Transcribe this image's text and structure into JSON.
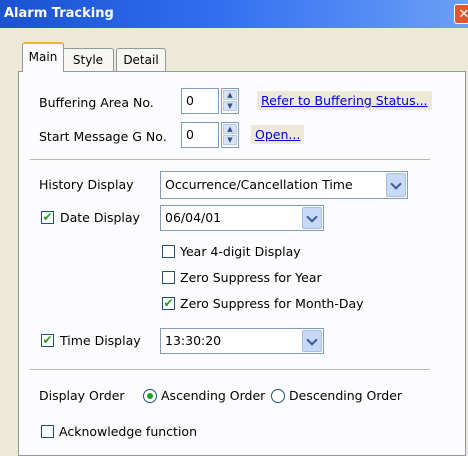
{
  "window": {
    "title": "Alarm Tracking",
    "close_glyph": "✕"
  },
  "tabs": [
    {
      "label": "Main",
      "active": true
    },
    {
      "label": "Style",
      "active": false
    },
    {
      "label": "Detail",
      "active": false
    }
  ],
  "buffering": {
    "label": "Buffering Area No.",
    "value": "0",
    "link": "Refer to Buffering Status..."
  },
  "start_message": {
    "label": "Start Message  G No.",
    "value": "0",
    "link": "Open..."
  },
  "history": {
    "label": "History Display",
    "selected": "Occurrence/Cancellation Time"
  },
  "date_display": {
    "label": "Date Display",
    "checked": true,
    "selected": "06/04/01"
  },
  "options": [
    {
      "label": "Year 4-digit Display",
      "checked": false
    },
    {
      "label": "Zero Suppress for Year",
      "checked": false
    },
    {
      "label": "Zero Suppress for Month-Day",
      "checked": true
    }
  ],
  "time_display": {
    "label": "Time Display",
    "checked": true,
    "selected": "13:30:20"
  },
  "display_order": {
    "label": "Display Order",
    "ascending": "Ascending Order",
    "descending": "Descending Order",
    "selected": "ascending"
  },
  "acknowledge": {
    "label": "Acknowledge function",
    "checked": false
  },
  "icons": {
    "check": "✔",
    "spin_up": "▲",
    "spin_down": "▼"
  }
}
